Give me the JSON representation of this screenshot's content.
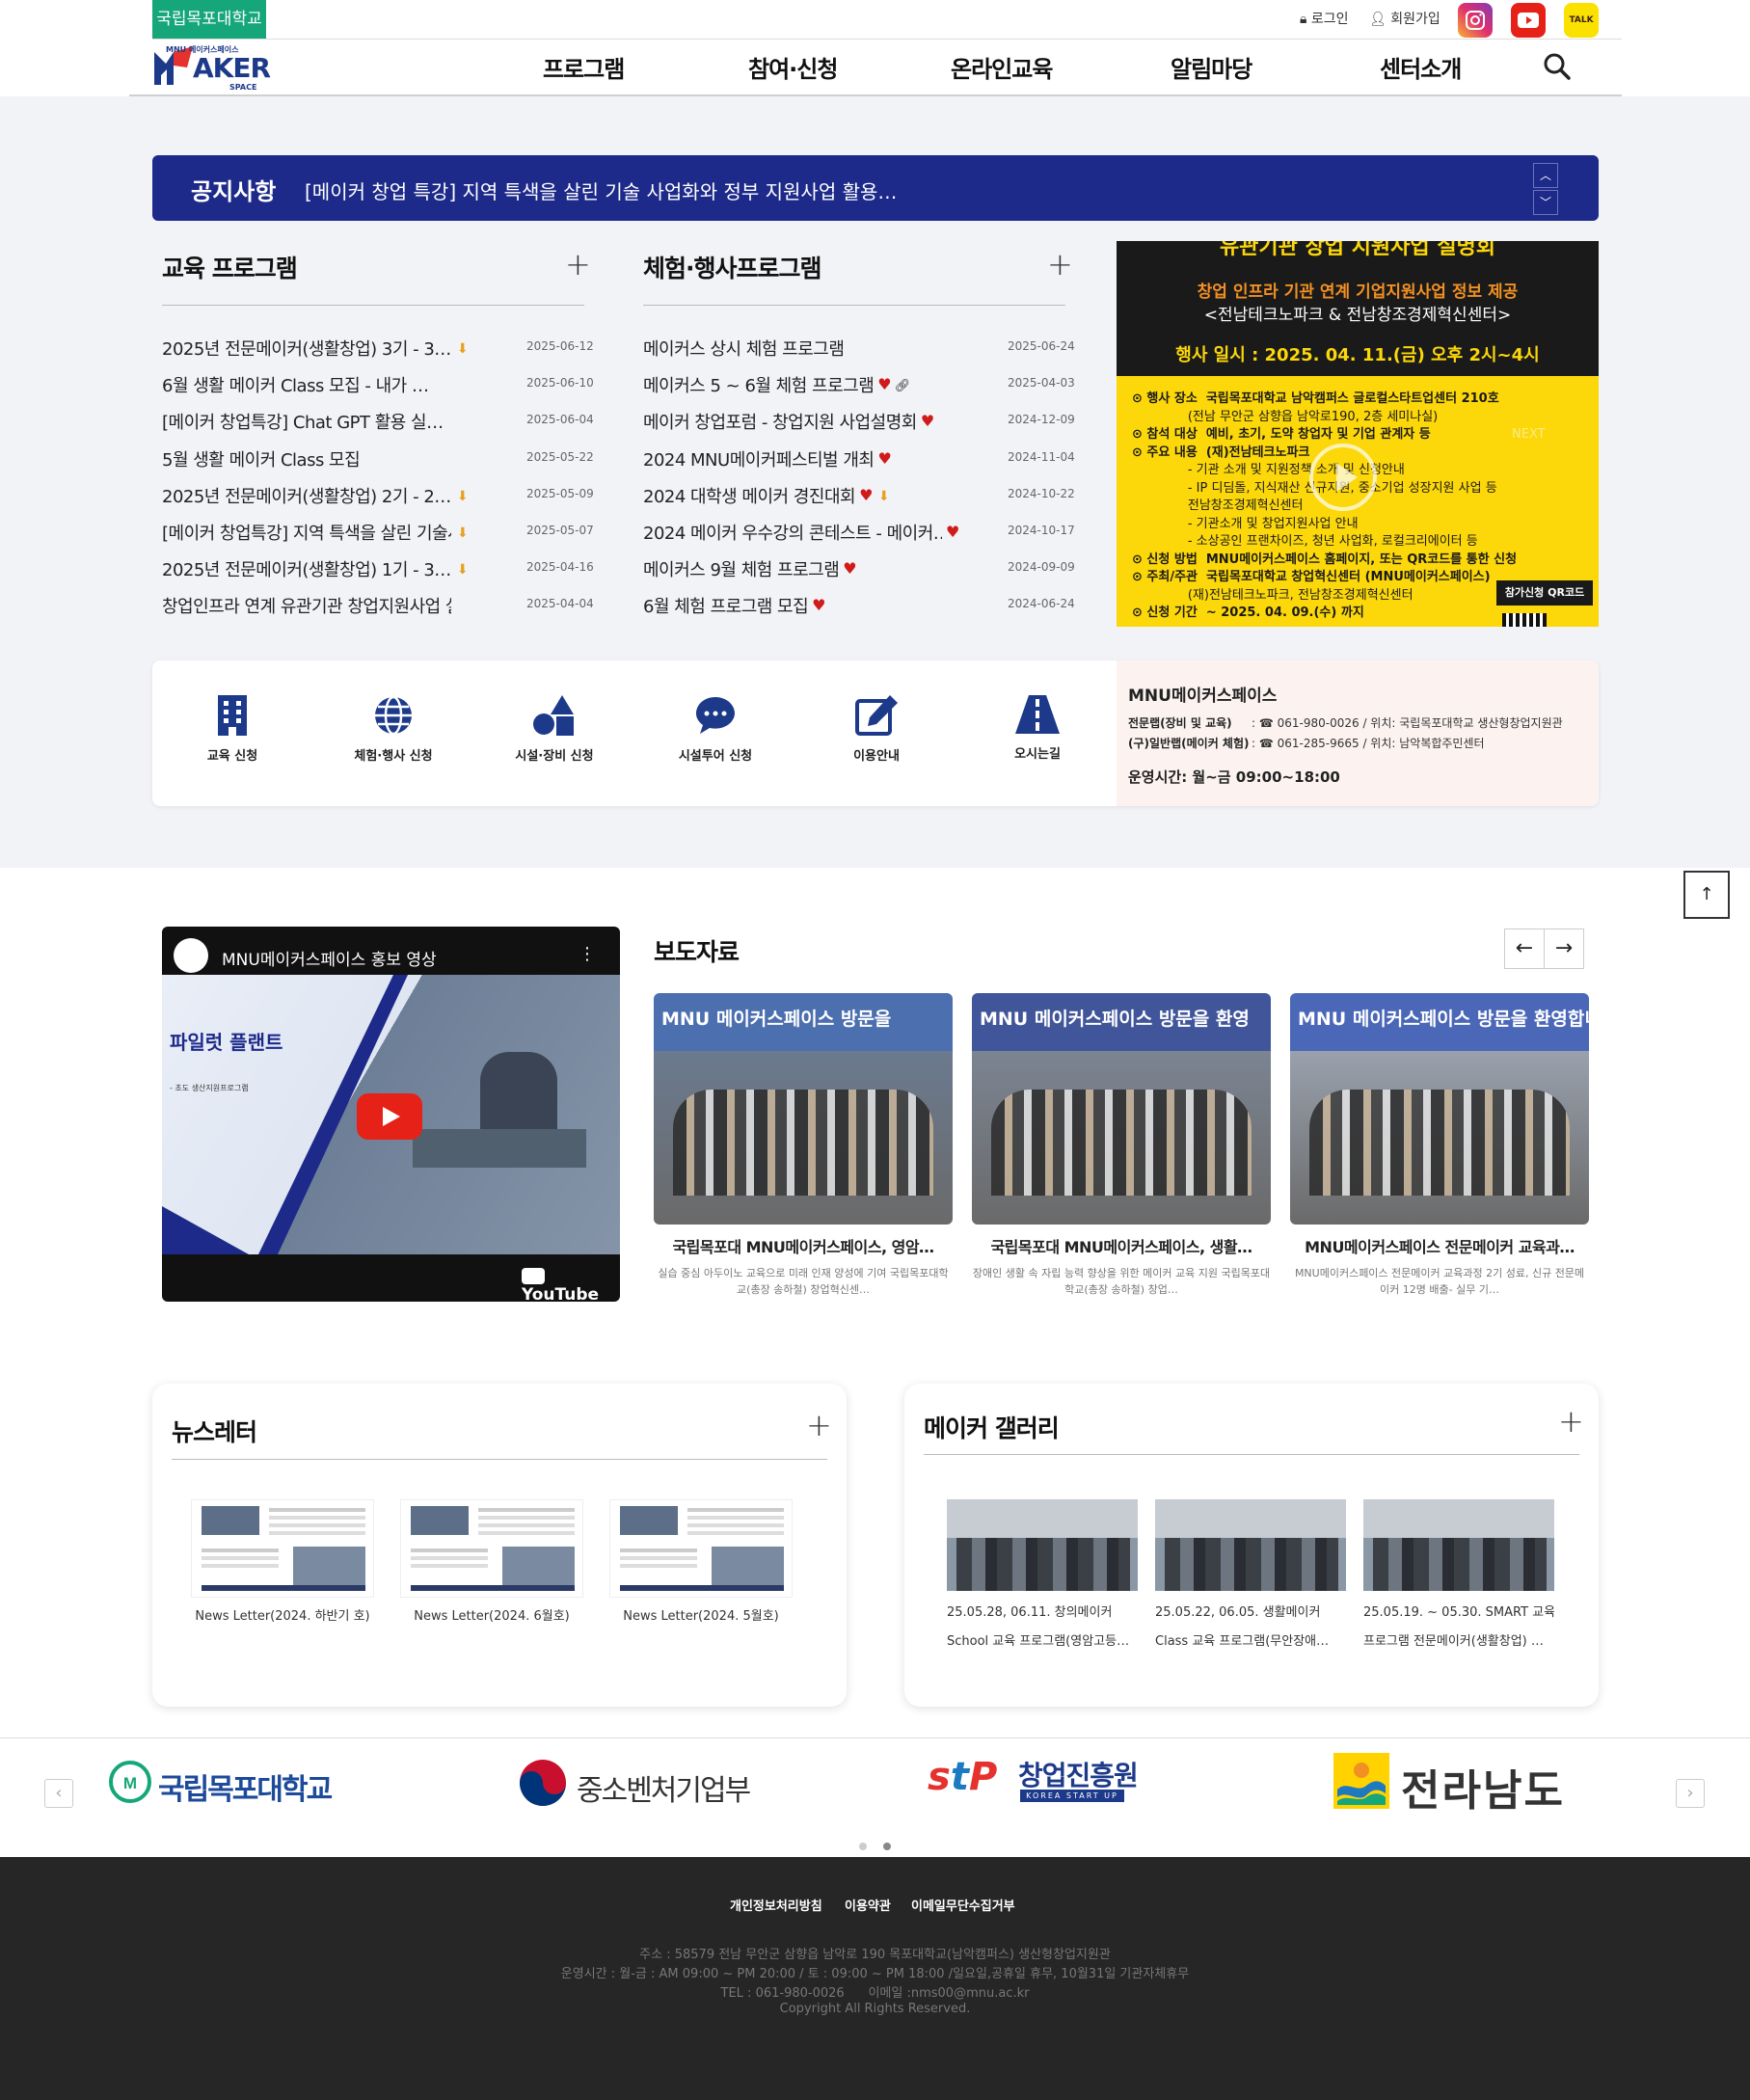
{
  "top": {
    "univ": "국립목포대학교",
    "login": "로그인",
    "join": "회원가입",
    "kakao": "TALK"
  },
  "nav": [
    "프로그램",
    "참여·신청",
    "온라인교육",
    "알림마당",
    "센터소개"
  ],
  "logo": {
    "small": "MNU 메이커스페이스",
    "big": "AKER",
    "sub": "SPACE"
  },
  "notice": {
    "title": "공지사항",
    "text": "[메이커 창업 특강] 지역 특색을 살린 기술 사업화와 정부 지원사업 활용…"
  },
  "edu": {
    "title": "교육 프로그램",
    "items": [
      {
        "t": "2025년 전문메이커(생활창업) 3기 - 3…",
        "d": "2025-06-12",
        "dl": true
      },
      {
        "t": "6월 생활 메이커 Class 모집 - 내가 …",
        "d": "2025-06-10",
        "dl": false
      },
      {
        "t": "[메이커 창업특강] Chat GPT 활용 실…",
        "d": "2025-06-04",
        "dl": false
      },
      {
        "t": "5월 생활 메이커 Class 모집",
        "d": "2025-05-22",
        "dl": false
      },
      {
        "t": "2025년 전문메이커(생활창업) 2기 - 2…",
        "d": "2025-05-09",
        "dl": true
      },
      {
        "t": "[메이커 창업특강] 지역 특색을 살린 기술사…",
        "d": "2025-05-07",
        "dl": true
      },
      {
        "t": "2025년 전문메이커(생활창업) 1기 - 3…",
        "d": "2025-04-16",
        "dl": true
      },
      {
        "t": "창업인프라 연계 유관기관 창업지원사업 설명회",
        "d": "2025-04-04",
        "dl": false
      }
    ]
  },
  "event": {
    "title": "체험·행사프로그램",
    "items": [
      {
        "t": "메이커스 상시 체험 프로그램",
        "d": "2025-06-24",
        "h": false,
        "l": false,
        "dl": false
      },
      {
        "t": "메이커스 5 ~ 6월 체험 프로그램",
        "d": "2025-04-03",
        "h": true,
        "l": true,
        "dl": false
      },
      {
        "t": "메이커 창업포럼 - 창업지원 사업설명회",
        "d": "2024-12-09",
        "h": true,
        "l": false,
        "dl": false
      },
      {
        "t": "2024 MNU메이커페스티벌 개최",
        "d": "2024-11-04",
        "h": true,
        "l": false,
        "dl": false
      },
      {
        "t": "2024 대학생 메이커 경진대회",
        "d": "2024-10-22",
        "h": true,
        "l": false,
        "dl": true
      },
      {
        "t": "2024 메이커 우수강의 콘테스트 - 메이커…",
        "d": "2024-10-17",
        "h": true,
        "l": false,
        "dl": false
      },
      {
        "t": "메이커스 9월 체험 프로그램",
        "d": "2024-09-09",
        "h": true,
        "l": false,
        "dl": false
      },
      {
        "t": "6월 체험 프로그램 모집",
        "d": "2024-06-24",
        "h": true,
        "l": false,
        "dl": false
      }
    ]
  },
  "poster": {
    "head": "유관기관 창업 지원사업 설명회",
    "l1": "창업 인프라 기관 연계 기업지원사업 정보 제공",
    "l2": "<전남테크노파크 & 전남창조경제혁신센터>",
    "l3": "행사 일시 : 2025. 04. 11.(금) 오후 2시~4시",
    "rows": [
      "⊙ 행사 장소  국립목포대학교 남악캠퍼스 글로컬스타트업센터 210호",
      "              (전남 무안군 삼향읍 남악로190, 2층 세미나실)",
      "⊙ 참석 대상  예비, 초기, 도약 창업자 및 기업 관계자 등",
      "⊙ 주요 내용  (재)전남테크노파크",
      "              - 기관 소개 및 지원정책 소개 및 신청안내",
      "              - IP 디딤돌, 지식재산 신규지원, 중소기업 성장지원 사업 등",
      "              전남창조경제혁신센터",
      "              - 기관소개 및 창업지원사업 안내",
      "              - 소상공인 프랜차이즈, 청년 사업화, 로컬크리에이터 등",
      "⊙ 신청 방법  MNU메이커스페이스 홈페이지, 또는 QR코드를 통한 신청",
      "⊙ 주최/주관  국립목포대학교 창업혁신센터 (MNU메이커스페이스)",
      "              (재)전남테크노파크, 전남창조경제혁신센터",
      "⊙ 신청 기간  ~ 2025. 04. 09.(수) 까지"
    ],
    "qr": "참가신청 QR코드",
    "next": "NEXT"
  },
  "quick": [
    "교육 신청",
    "체험·행사 신청",
    "시설·장비 신청",
    "시설투어 신청",
    "이용안내",
    "오시는길"
  ],
  "contact": {
    "title": "MNU메이커스페이스",
    "r1k": "전문랩(장비 및 교육)",
    "r1v": ": ☎ 061-980-0026 / 위치: 국립목포대학교 생산형창업지원관",
    "r2k": "(구)일반랩(메이커 체험)",
    "r2v": ": ☎ 061-285-9665 / 위치: 남악복합주민센터",
    "hours": "운영시간: 월~금 09:00~18:00"
  },
  "video": {
    "title": "MNU메이커스페이스 홍보 영상",
    "big": "파일럿 플랜트",
    "small": "- 초도 생산지원프로그램",
    "yt": "YouTube"
  },
  "press": {
    "title": "보도자료",
    "items": [
      {
        "banner": "MNU 메이커스페이스 방문을",
        "t": "국립목포대 MNU메이커스페이스, 영암…",
        "d": "실습 중심 아두이노 교육으로 미래 인재 양성에 기여 국립목포대학교(총장 송하철) 창업혁신센…"
      },
      {
        "banner": "MNU 메이커스페이스 방문을 환영",
        "t": "국립목포대 MNU메이커스페이스, 생활…",
        "d": "장애인 생활 속 자립 능력 향상을 위한 메이커 교육 지원 국립목포대학교(총장 송하철) 창업…"
      },
      {
        "banner": "MNU 메이커스페이스 방문을 환영합니다",
        "t": "MNU메이커스페이스 전문메이커 교육과…",
        "d": "MNU메이커스페이스 전문메이커 교육과정 2기 성료, 신규 전문메이커 12명 배출- 실무 기…"
      }
    ]
  },
  "newsletter": {
    "title": "뉴스레터",
    "items": [
      "News Letter(2024. 하반기 호)",
      "News Letter(2024. 6월호)",
      "News Letter(2024. 5월호)"
    ]
  },
  "gallery": {
    "title": "메이커 갤러리",
    "items": [
      {
        "a": "25.05.28, 06.11. 창의메이커",
        "b": "School 교육 프로그램(영암고등…"
      },
      {
        "a": "25.05.22, 06.05. 생활메이커",
        "b": "Class 교육 프로그램(무안장애…"
      },
      {
        "a": "25.05.19. ~ 05.30. SMART 교육",
        "b": "프로그램 전문메이커(생활창업) …"
      }
    ]
  },
  "partners": [
    "국립목포대학교",
    "중소벤처기업부",
    "창업진흥원",
    "전라남도"
  ],
  "partners_sub": "KOREA START UP",
  "footer": {
    "links": [
      "개인정보처리방침",
      "이용약관",
      "이메일무단수집거부"
    ],
    "addr": "주소 : 58579 전남 무안군 삼향읍 남악로 190 목포대학교(남악캠퍼스) 생산형창업지원관",
    "hours": "운영시간 : 월-금 : AM 09:00 ~ PM 20:00 / 토 : 09:00 ~ PM 18:00 /일요일,공휴일 휴무, 10월31일 기관자체휴무",
    "tel": "TEL : 061-980-0026      이메일 :nms00@mnu.ac.kr",
    "copy": "Copyright All Rights Reserved."
  },
  "colors": {
    "brand_green": "#15a679",
    "notice_navy": "#1d2a8a",
    "poster_yellow": "#fcd70a"
  }
}
